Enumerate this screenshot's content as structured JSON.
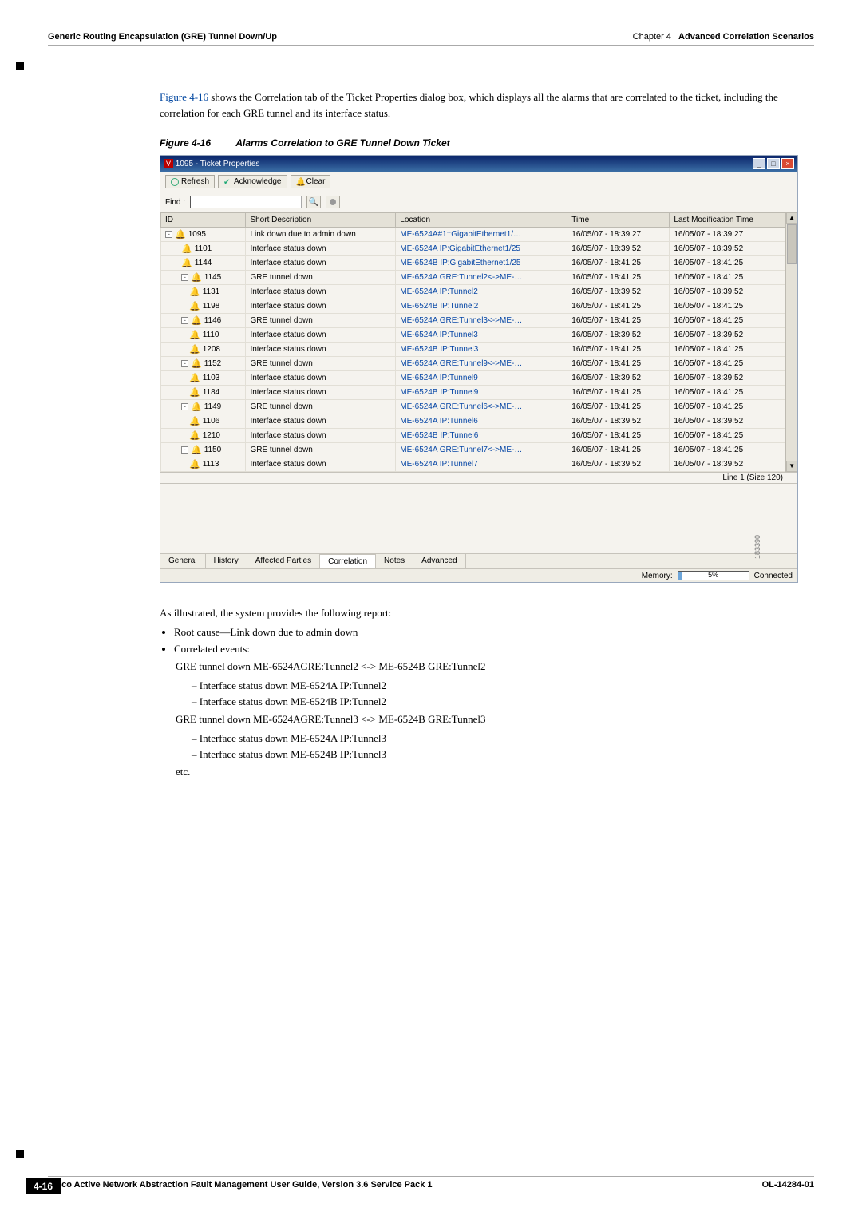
{
  "header": {
    "left": "Generic Routing Encapsulation (GRE) Tunnel Down/Up",
    "chapter": "Chapter 4",
    "chapter_title": "Advanced Correlation Scenarios"
  },
  "intro": {
    "link": "Figure 4-16",
    "text": " shows the Correlation tab of the Ticket Properties dialog box, which displays all the alarms that are correlated to the ticket, including the correlation for each GRE tunnel and its interface status."
  },
  "figure": {
    "num": "Figure 4-16",
    "title": "Alarms Correlation to GRE Tunnel Down Ticket"
  },
  "window": {
    "title": "1095 - Ticket Properties",
    "refresh": "Refresh",
    "ack": "Acknowledge",
    "clear": "Clear",
    "find": "Find :"
  },
  "columns": [
    "ID",
    "Short Description",
    "Location",
    "Time",
    "Last Modification Time"
  ],
  "rows": [
    {
      "id": "1095",
      "indent": 0,
      "exp": "-",
      "desc": "Link down due to admin down",
      "loc": "ME-6524A#1::GigabitEthernet1/…",
      "t": "16/05/07 - 18:39:27",
      "m": "16/05/07 - 18:39:27"
    },
    {
      "id": "1101",
      "indent": 1,
      "desc": "Interface status down",
      "loc": "ME-6524A IP:GigabitEthernet1/25",
      "t": "16/05/07 - 18:39:52",
      "m": "16/05/07 - 18:39:52"
    },
    {
      "id": "1144",
      "indent": 1,
      "desc": "Interface status down",
      "loc": "ME-6524B IP:GigabitEthernet1/25",
      "t": "16/05/07 - 18:41:25",
      "m": "16/05/07 - 18:41:25"
    },
    {
      "id": "1145",
      "indent": 1,
      "exp": "-",
      "desc": "GRE tunnel down",
      "loc": "ME-6524A GRE:Tunnel2<->ME-…",
      "t": "16/05/07 - 18:41:25",
      "m": "16/05/07 - 18:41:25"
    },
    {
      "id": "1131",
      "indent": 2,
      "desc": "Interface status down",
      "loc": "ME-6524A IP:Tunnel2",
      "t": "16/05/07 - 18:39:52",
      "m": "16/05/07 - 18:39:52"
    },
    {
      "id": "1198",
      "indent": 2,
      "desc": "Interface status down",
      "loc": "ME-6524B IP:Tunnel2",
      "t": "16/05/07 - 18:41:25",
      "m": "16/05/07 - 18:41:25"
    },
    {
      "id": "1146",
      "indent": 1,
      "exp": "-",
      "desc": "GRE tunnel down",
      "loc": "ME-6524A GRE:Tunnel3<->ME-…",
      "t": "16/05/07 - 18:41:25",
      "m": "16/05/07 - 18:41:25"
    },
    {
      "id": "1110",
      "indent": 2,
      "desc": "Interface status down",
      "loc": "ME-6524A IP:Tunnel3",
      "t": "16/05/07 - 18:39:52",
      "m": "16/05/07 - 18:39:52"
    },
    {
      "id": "1208",
      "indent": 2,
      "desc": "Interface status down",
      "loc": "ME-6524B IP:Tunnel3",
      "t": "16/05/07 - 18:41:25",
      "m": "16/05/07 - 18:41:25"
    },
    {
      "id": "1152",
      "indent": 1,
      "exp": "-",
      "desc": "GRE tunnel down",
      "loc": "ME-6524A GRE:Tunnel9<->ME-…",
      "t": "16/05/07 - 18:41:25",
      "m": "16/05/07 - 18:41:25"
    },
    {
      "id": "1103",
      "indent": 2,
      "desc": "Interface status down",
      "loc": "ME-6524A IP:Tunnel9",
      "t": "16/05/07 - 18:39:52",
      "m": "16/05/07 - 18:39:52"
    },
    {
      "id": "1184",
      "indent": 2,
      "desc": "Interface status down",
      "loc": "ME-6524B IP:Tunnel9",
      "t": "16/05/07 - 18:41:25",
      "m": "16/05/07 - 18:41:25"
    },
    {
      "id": "1149",
      "indent": 1,
      "exp": "-",
      "desc": "GRE tunnel down",
      "loc": "ME-6524A GRE:Tunnel6<->ME-…",
      "t": "16/05/07 - 18:41:25",
      "m": "16/05/07 - 18:41:25"
    },
    {
      "id": "1106",
      "indent": 2,
      "desc": "Interface status down",
      "loc": "ME-6524A IP:Tunnel6",
      "t": "16/05/07 - 18:39:52",
      "m": "16/05/07 - 18:39:52"
    },
    {
      "id": "1210",
      "indent": 2,
      "desc": "Interface status down",
      "loc": "ME-6524B IP:Tunnel6",
      "t": "16/05/07 - 18:41:25",
      "m": "16/05/07 - 18:41:25"
    },
    {
      "id": "1150",
      "indent": 1,
      "exp": "-",
      "desc": "GRE tunnel down",
      "loc": "ME-6524A GRE:Tunnel7<->ME-…",
      "t": "16/05/07 - 18:41:25",
      "m": "16/05/07 - 18:41:25"
    },
    {
      "id": "1113",
      "indent": 2,
      "desc": "Interface status down",
      "loc": "ME-6524A IP:Tunnel7",
      "t": "16/05/07 - 18:39:52",
      "m": "16/05/07 - 18:39:52"
    }
  ],
  "line_info": "Line 1 (Size 120)",
  "tabs": [
    "General",
    "History",
    "Affected Parties",
    "Correlation",
    "Notes",
    "Advanced"
  ],
  "active_tab": 3,
  "status": {
    "memory_label": "Memory:",
    "memory_pct": "5%",
    "connected": "Connected"
  },
  "img_num": "183390",
  "after": {
    "intro": "As illustrated, the system provides the following report:",
    "bullets": [
      "Root cause—Link down due to admin down",
      "Correlated events:"
    ],
    "events": [
      {
        "title": "GRE tunnel down ME-6524AGRE:Tunnel2 <-> ME-6524B GRE:Tunnel2",
        "subs": [
          "Interface status down ME-6524A IP:Tunnel2",
          "Interface status down ME-6524B IP:Tunnel2"
        ]
      },
      {
        "title": "GRE tunnel down ME-6524AGRE:Tunnel3 <-> ME-6524B GRE:Tunnel3",
        "subs": [
          "Interface status down ME-6524A IP:Tunnel3",
          "Interface status down ME-6524B IP:Tunnel3"
        ]
      }
    ],
    "etc": "etc."
  },
  "footer": {
    "title": "Cisco Active Network Abstraction Fault Management User Guide, Version 3.6 Service Pack 1",
    "right": "OL-14284-01",
    "page": "4-16"
  }
}
